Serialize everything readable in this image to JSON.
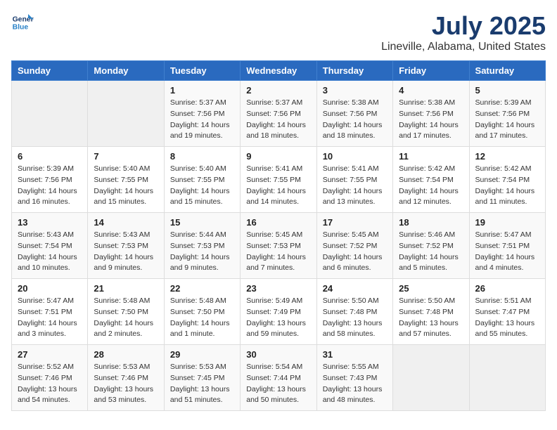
{
  "header": {
    "logo_line1": "General",
    "logo_line2": "Blue",
    "month": "July 2025",
    "location": "Lineville, Alabama, United States"
  },
  "days_of_week": [
    "Sunday",
    "Monday",
    "Tuesday",
    "Wednesday",
    "Thursday",
    "Friday",
    "Saturday"
  ],
  "weeks": [
    [
      {
        "day": "",
        "sunrise": "",
        "sunset": "",
        "daylight": ""
      },
      {
        "day": "",
        "sunrise": "",
        "sunset": "",
        "daylight": ""
      },
      {
        "day": "1",
        "sunrise": "Sunrise: 5:37 AM",
        "sunset": "Sunset: 7:56 PM",
        "daylight": "Daylight: 14 hours and 19 minutes."
      },
      {
        "day": "2",
        "sunrise": "Sunrise: 5:37 AM",
        "sunset": "Sunset: 7:56 PM",
        "daylight": "Daylight: 14 hours and 18 minutes."
      },
      {
        "day": "3",
        "sunrise": "Sunrise: 5:38 AM",
        "sunset": "Sunset: 7:56 PM",
        "daylight": "Daylight: 14 hours and 18 minutes."
      },
      {
        "day": "4",
        "sunrise": "Sunrise: 5:38 AM",
        "sunset": "Sunset: 7:56 PM",
        "daylight": "Daylight: 14 hours and 17 minutes."
      },
      {
        "day": "5",
        "sunrise": "Sunrise: 5:39 AM",
        "sunset": "Sunset: 7:56 PM",
        "daylight": "Daylight: 14 hours and 17 minutes."
      }
    ],
    [
      {
        "day": "6",
        "sunrise": "Sunrise: 5:39 AM",
        "sunset": "Sunset: 7:56 PM",
        "daylight": "Daylight: 14 hours and 16 minutes."
      },
      {
        "day": "7",
        "sunrise": "Sunrise: 5:40 AM",
        "sunset": "Sunset: 7:55 PM",
        "daylight": "Daylight: 14 hours and 15 minutes."
      },
      {
        "day": "8",
        "sunrise": "Sunrise: 5:40 AM",
        "sunset": "Sunset: 7:55 PM",
        "daylight": "Daylight: 14 hours and 15 minutes."
      },
      {
        "day": "9",
        "sunrise": "Sunrise: 5:41 AM",
        "sunset": "Sunset: 7:55 PM",
        "daylight": "Daylight: 14 hours and 14 minutes."
      },
      {
        "day": "10",
        "sunrise": "Sunrise: 5:41 AM",
        "sunset": "Sunset: 7:55 PM",
        "daylight": "Daylight: 14 hours and 13 minutes."
      },
      {
        "day": "11",
        "sunrise": "Sunrise: 5:42 AM",
        "sunset": "Sunset: 7:54 PM",
        "daylight": "Daylight: 14 hours and 12 minutes."
      },
      {
        "day": "12",
        "sunrise": "Sunrise: 5:42 AM",
        "sunset": "Sunset: 7:54 PM",
        "daylight": "Daylight: 14 hours and 11 minutes."
      }
    ],
    [
      {
        "day": "13",
        "sunrise": "Sunrise: 5:43 AM",
        "sunset": "Sunset: 7:54 PM",
        "daylight": "Daylight: 14 hours and 10 minutes."
      },
      {
        "day": "14",
        "sunrise": "Sunrise: 5:43 AM",
        "sunset": "Sunset: 7:53 PM",
        "daylight": "Daylight: 14 hours and 9 minutes."
      },
      {
        "day": "15",
        "sunrise": "Sunrise: 5:44 AM",
        "sunset": "Sunset: 7:53 PM",
        "daylight": "Daylight: 14 hours and 9 minutes."
      },
      {
        "day": "16",
        "sunrise": "Sunrise: 5:45 AM",
        "sunset": "Sunset: 7:53 PM",
        "daylight": "Daylight: 14 hours and 7 minutes."
      },
      {
        "day": "17",
        "sunrise": "Sunrise: 5:45 AM",
        "sunset": "Sunset: 7:52 PM",
        "daylight": "Daylight: 14 hours and 6 minutes."
      },
      {
        "day": "18",
        "sunrise": "Sunrise: 5:46 AM",
        "sunset": "Sunset: 7:52 PM",
        "daylight": "Daylight: 14 hours and 5 minutes."
      },
      {
        "day": "19",
        "sunrise": "Sunrise: 5:47 AM",
        "sunset": "Sunset: 7:51 PM",
        "daylight": "Daylight: 14 hours and 4 minutes."
      }
    ],
    [
      {
        "day": "20",
        "sunrise": "Sunrise: 5:47 AM",
        "sunset": "Sunset: 7:51 PM",
        "daylight": "Daylight: 14 hours and 3 minutes."
      },
      {
        "day": "21",
        "sunrise": "Sunrise: 5:48 AM",
        "sunset": "Sunset: 7:50 PM",
        "daylight": "Daylight: 14 hours and 2 minutes."
      },
      {
        "day": "22",
        "sunrise": "Sunrise: 5:48 AM",
        "sunset": "Sunset: 7:50 PM",
        "daylight": "Daylight: 14 hours and 1 minute."
      },
      {
        "day": "23",
        "sunrise": "Sunrise: 5:49 AM",
        "sunset": "Sunset: 7:49 PM",
        "daylight": "Daylight: 13 hours and 59 minutes."
      },
      {
        "day": "24",
        "sunrise": "Sunrise: 5:50 AM",
        "sunset": "Sunset: 7:48 PM",
        "daylight": "Daylight: 13 hours and 58 minutes."
      },
      {
        "day": "25",
        "sunrise": "Sunrise: 5:50 AM",
        "sunset": "Sunset: 7:48 PM",
        "daylight": "Daylight: 13 hours and 57 minutes."
      },
      {
        "day": "26",
        "sunrise": "Sunrise: 5:51 AM",
        "sunset": "Sunset: 7:47 PM",
        "daylight": "Daylight: 13 hours and 55 minutes."
      }
    ],
    [
      {
        "day": "27",
        "sunrise": "Sunrise: 5:52 AM",
        "sunset": "Sunset: 7:46 PM",
        "daylight": "Daylight: 13 hours and 54 minutes."
      },
      {
        "day": "28",
        "sunrise": "Sunrise: 5:53 AM",
        "sunset": "Sunset: 7:46 PM",
        "daylight": "Daylight: 13 hours and 53 minutes."
      },
      {
        "day": "29",
        "sunrise": "Sunrise: 5:53 AM",
        "sunset": "Sunset: 7:45 PM",
        "daylight": "Daylight: 13 hours and 51 minutes."
      },
      {
        "day": "30",
        "sunrise": "Sunrise: 5:54 AM",
        "sunset": "Sunset: 7:44 PM",
        "daylight": "Daylight: 13 hours and 50 minutes."
      },
      {
        "day": "31",
        "sunrise": "Sunrise: 5:55 AM",
        "sunset": "Sunset: 7:43 PM",
        "daylight": "Daylight: 13 hours and 48 minutes."
      },
      {
        "day": "",
        "sunrise": "",
        "sunset": "",
        "daylight": ""
      },
      {
        "day": "",
        "sunrise": "",
        "sunset": "",
        "daylight": ""
      }
    ]
  ]
}
